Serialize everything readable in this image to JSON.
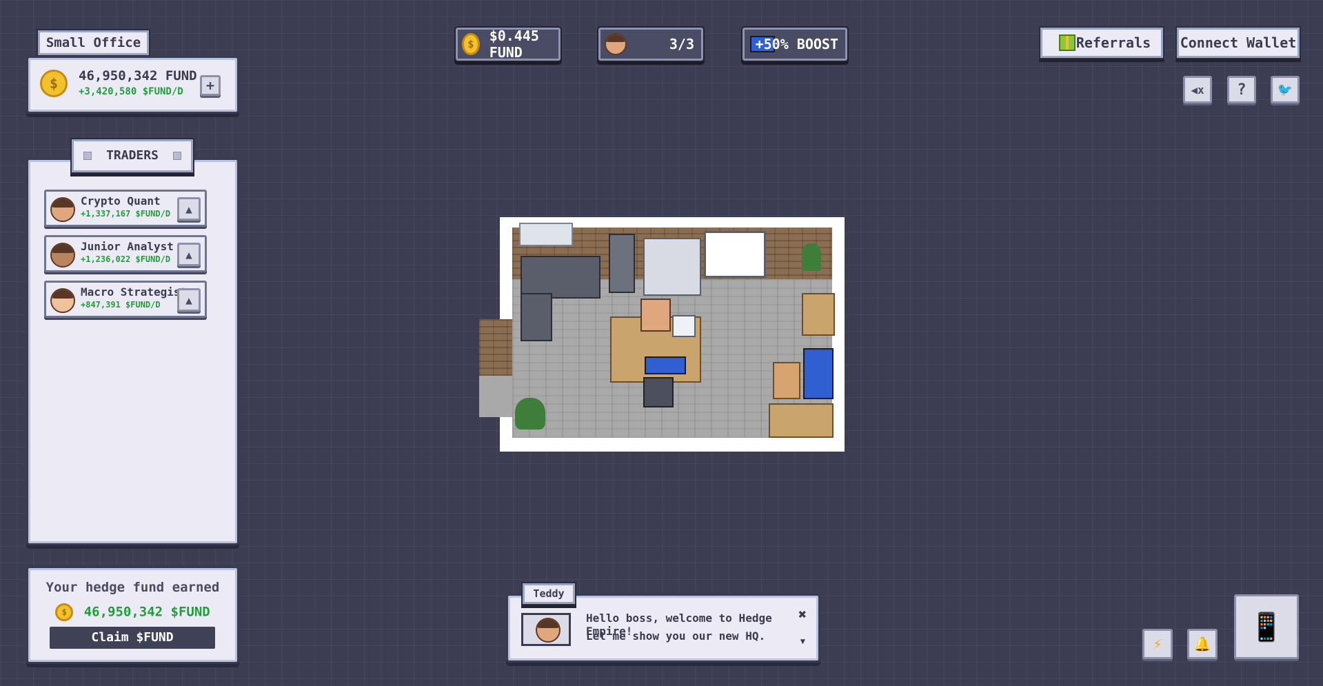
{
  "office": {
    "label": "Small Office"
  },
  "balance": {
    "amount": "46,950,342 FUND",
    "rate": "+3,420,580 $FUND/D"
  },
  "hud": {
    "price": "$0.445 FUND",
    "traders_count": "3/3",
    "boost": "+50% BOOST"
  },
  "top_right": {
    "referrals": "Referrals",
    "connect_wallet": "Connect Wallet"
  },
  "traders_panel": {
    "title": "TRADERS",
    "items": [
      {
        "name": "Crypto Quant",
        "rate": "+1,337,167 $FUND/D"
      },
      {
        "name": "Junior Analyst",
        "rate": "+1,236,022 $FUND/D"
      },
      {
        "name": "Macro Strategist",
        "rate": "+847,391 $FUND/D"
      }
    ]
  },
  "earned": {
    "title": "Your hedge fund earned",
    "amount": "46,950,342 $FUND",
    "claim": "Claim $FUND"
  },
  "dialog": {
    "speaker": "Teddy",
    "line1": "Hello boss, welcome to Hedge Empire!",
    "line2": "Let me show you our new HQ."
  },
  "icons": {
    "coin": "coin-icon",
    "sound": "speaker-muted-icon",
    "help": "question-icon",
    "twitter": "twitter-icon",
    "bolt": "lightning-icon",
    "bell": "bell-icon",
    "phone": "phone-icon",
    "gift": "gift-icon",
    "monitor": "monitor-icon",
    "plus": "plus-icon",
    "upgrade": "arrow-up-icon",
    "close": "close-icon"
  },
  "colors": {
    "background": "#3c3c52",
    "panel": "#eceaf4",
    "accent_green": "#1e9f3a",
    "coin_gold": "#f1c22b"
  }
}
